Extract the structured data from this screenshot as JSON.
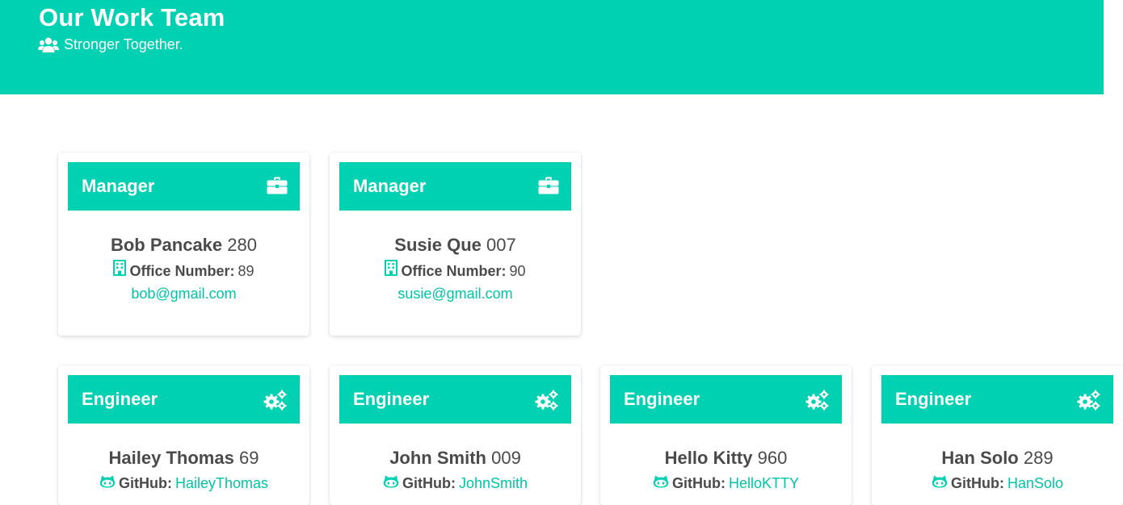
{
  "hero": {
    "title": "Our Work Team",
    "subtitle": "Stronger Together.",
    "subtitle_icon": "users-icon",
    "color": "#00d1b2"
  },
  "managers": [
    {
      "role": "Manager",
      "icon": "briefcase-icon",
      "name": "Bob Pancake",
      "id": "280",
      "office_label": "Office Number:",
      "office_number": "89",
      "email": "bob@gmail.com"
    },
    {
      "role": "Manager",
      "icon": "briefcase-icon",
      "name": "Susie Que",
      "id": "007",
      "office_label": "Office Number:",
      "office_number": "90",
      "email": "susie@gmail.com"
    }
  ],
  "engineers": [
    {
      "role": "Engineer",
      "icon": "cogs-icon",
      "name": "Hailey Thomas",
      "id": "69",
      "github_label": "GitHub:",
      "github": "HaileyThomas"
    },
    {
      "role": "Engineer",
      "icon": "cogs-icon",
      "name": "John Smith",
      "id": "009",
      "github_label": "GitHub:",
      "github": "JohnSmith"
    },
    {
      "role": "Engineer",
      "icon": "cogs-icon",
      "name": "Hello Kitty",
      "id": "960",
      "github_label": "GitHub:",
      "github": "HelloKTTY"
    },
    {
      "role": "Engineer",
      "icon": "cogs-icon",
      "name": "Han Solo",
      "id": "289",
      "github_label": "GitHub:",
      "github": "HanSolo"
    }
  ],
  "accent_color": "#00d1b2",
  "link_color": "#00c4a7"
}
